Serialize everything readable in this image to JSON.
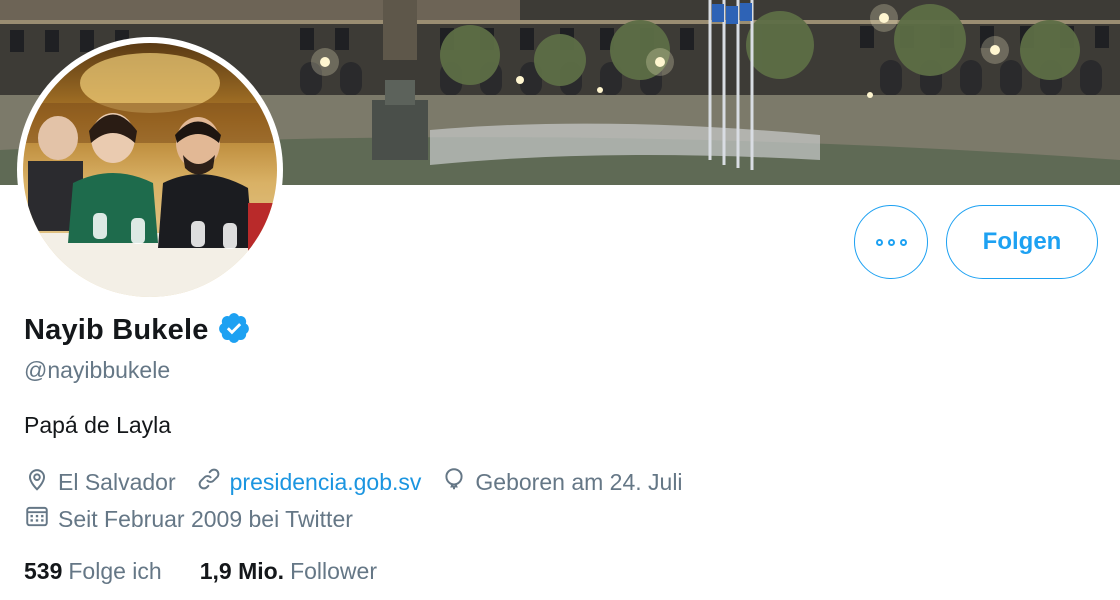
{
  "profile": {
    "name": "Nayib Bukele",
    "handle": "@nayibbukele",
    "bio": "Papá de Layla",
    "location": "El Salvador",
    "website": "presidencia.gob.sv",
    "birthday": "Geboren am 24. Juli",
    "joined": "Seit Februar 2009 bei Twitter",
    "verified": true
  },
  "actions": {
    "follow_label": "Folgen",
    "more_icon": "more-dots-icon"
  },
  "stats": {
    "following_count": "539",
    "following_label": "Folge ich",
    "followers_count": "1,9 Mio.",
    "followers_label": "Follower"
  },
  "icons": {
    "location": "location-pin-icon",
    "website": "link-icon",
    "birthday": "balloon-icon",
    "joined": "calendar-icon",
    "verified": "verified-badge-icon"
  },
  "colors": {
    "accent": "#1da1f2",
    "link": "#1b95e0",
    "secondary_text": "#657786",
    "primary_text": "#14171a"
  }
}
